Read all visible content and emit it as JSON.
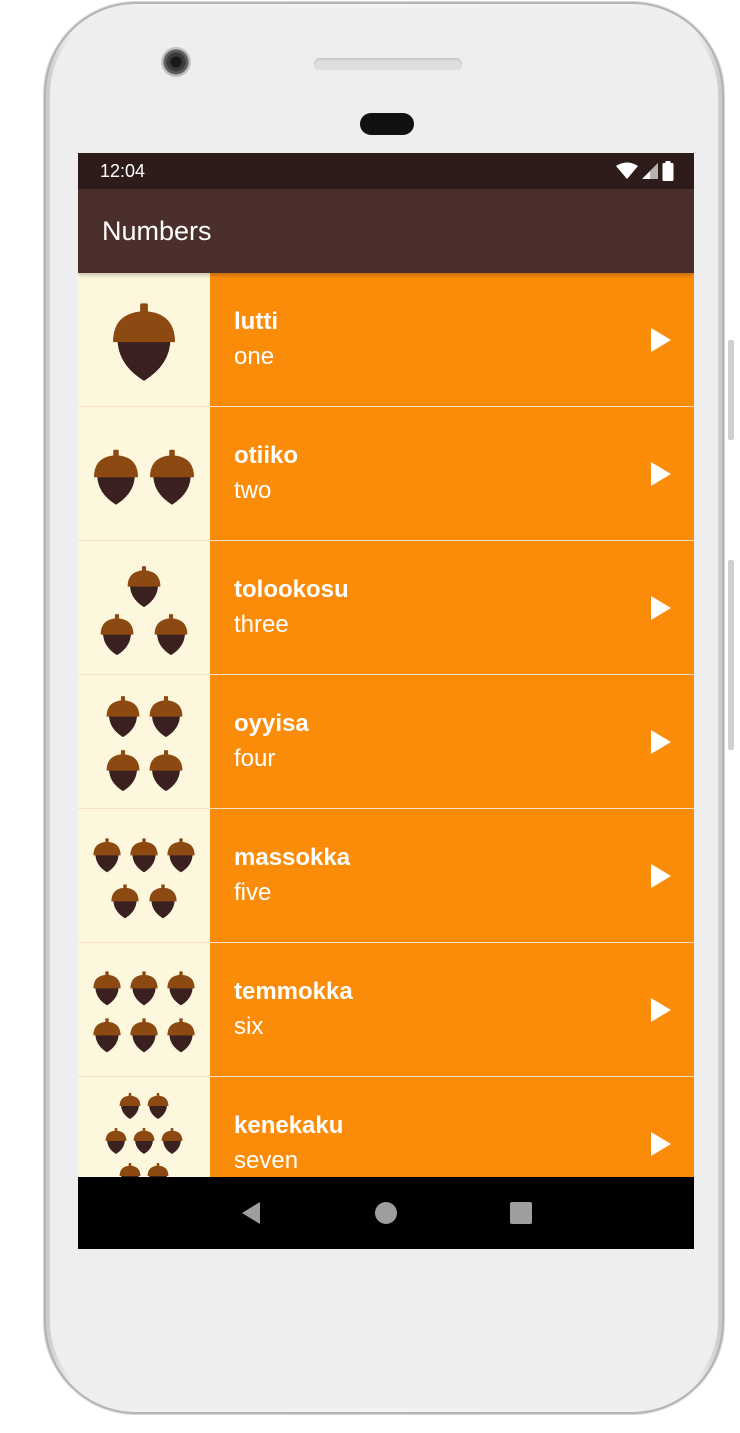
{
  "status_bar": {
    "time": "12:04",
    "icons": [
      "wifi-icon",
      "signal-icon",
      "battery-icon"
    ]
  },
  "app_bar": {
    "title": "Numbers"
  },
  "colors": {
    "accent_row": "#fb8c09",
    "image_bg": "#fdf7de",
    "app_bar": "#4b2f2b",
    "status_bar": "#2e1c1a"
  },
  "words": [
    {
      "native": "lutti",
      "english": "one",
      "acorns": 1,
      "icon": "play-icon"
    },
    {
      "native": "otiiko",
      "english": "two",
      "acorns": 2,
      "icon": "play-icon"
    },
    {
      "native": "tolookosu",
      "english": "three",
      "acorns": 3,
      "icon": "play-icon"
    },
    {
      "native": "oyyisa",
      "english": "four",
      "acorns": 4,
      "icon": "play-icon"
    },
    {
      "native": "massokka",
      "english": "five",
      "acorns": 5,
      "icon": "play-icon"
    },
    {
      "native": "temmokka",
      "english": "six",
      "acorns": 6,
      "icon": "play-icon"
    },
    {
      "native": "kenekaku",
      "english": "seven",
      "acorns": 7,
      "icon": "play-icon"
    }
  ],
  "nav_bar": {
    "buttons": [
      "back-icon",
      "home-icon",
      "recents-icon"
    ]
  }
}
